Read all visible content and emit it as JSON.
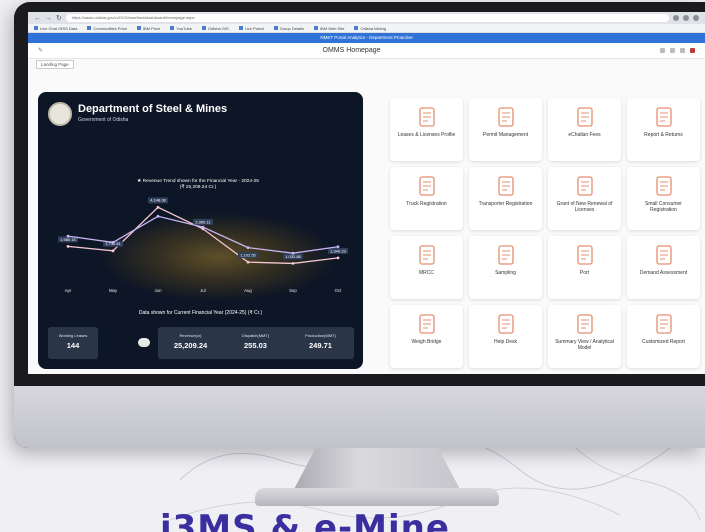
{
  "browser": {
    "url": "https://oasis.odisha.gov.in/OGS/eusrflash/dashboard/homepage.aspx",
    "bookmarks": [
      "Live Chat ORIS Data",
      "Commodities Price",
      "IBM Price",
      "YouTube",
      "Odisha GIS",
      "Live Portal",
      "Group Details",
      "IBM Web Site",
      "Odisha Mining"
    ]
  },
  "app_bar": {
    "title": "NMET Portal Analytics - Department Proactive"
  },
  "page": {
    "title": "OMMS Homepage",
    "subtab": "Landing Page"
  },
  "dashboard": {
    "dept_title": "Department of Steel & Mines",
    "dept_subtitle": "Government of Odisha",
    "revenue_title_1": "★ Revenue Trend shown for the Financial Year - 2024-25",
    "revenue_title_2": "(₹ 25,209.24 Cr.)",
    "data_shown": "Data shown for Current Financial Year (2024-25) (₹ Cr.)",
    "stats": {
      "working_leases": {
        "label": "Working Leases",
        "value": "144"
      },
      "revenue": {
        "label": "Revenue(cr)",
        "value": "25,209.24"
      },
      "dispatch": {
        "label": "Dispatch(MMT)",
        "value": "255.03"
      },
      "production": {
        "label": "Production(MMT)",
        "value": "249.71"
      }
    }
  },
  "chart_data": {
    "type": "line",
    "title": "Revenue Trend shown for the Financial Year - 2024-25 (₹ 25,209.24 Cr.)",
    "categories": [
      "Apr",
      "May",
      "Jun",
      "Jul",
      "Aug",
      "Sep",
      "Oct"
    ],
    "series": [
      {
        "name": "Revenue",
        "values": [
          1980,
          1732,
          4148,
          2950,
          1102,
          1032,
          1340
        ],
        "labels": [
          "1,980.15",
          "1,732.61",
          "4,148.08",
          "2,950.11",
          "1,102.55",
          "1,032.88",
          "1,340.23"
        ],
        "color": "#f3c6d0"
      },
      {
        "name": "Trend",
        "values": [
          2550,
          2200,
          3650,
          3050,
          1910,
          1600,
          1960
        ],
        "color": "#c9b3f0"
      }
    ],
    "ylim": [
      0,
      5000
    ],
    "legend": "none",
    "grid": false
  },
  "tiles": [
    {
      "label": "Leases & Licenses Profile",
      "icon": "doc-icon"
    },
    {
      "label": "Permit Management",
      "icon": "permit-icon"
    },
    {
      "label": "eChallan Fees",
      "icon": "challan-icon"
    },
    {
      "label": "Report & Returns",
      "icon": "report-icon"
    },
    {
      "label": "Truck Registration",
      "icon": "truck-icon"
    },
    {
      "label": "Transporter Registration",
      "icon": "transporter-icon"
    },
    {
      "label": "Grant of New Renewal of Licenses",
      "icon": "grant-icon"
    },
    {
      "label": "Small Consumer Registration",
      "icon": "consumer-icon"
    },
    {
      "label": "MRCC",
      "icon": "mrcc-icon"
    },
    {
      "label": "Sampling",
      "icon": "sampling-icon"
    },
    {
      "label": "Port",
      "icon": "port-icon"
    },
    {
      "label": "Demand Assessment",
      "icon": "demand-icon"
    },
    {
      "label": "Weigh Bridge",
      "icon": "weighbridge-icon"
    },
    {
      "label": "Help Desk",
      "icon": "helpdesk-icon"
    },
    {
      "label": "Summary View / Analytical Model",
      "icon": "summary-icon"
    },
    {
      "label": "Customized Report",
      "icon": "custom-report-icon"
    }
  ],
  "brand": {
    "text": "i3MS & e-Mine"
  },
  "colors": {
    "tile_icon": "#e58f6f",
    "dashboard_bg": "#0d1626",
    "app_bar": "#2f73d8"
  }
}
